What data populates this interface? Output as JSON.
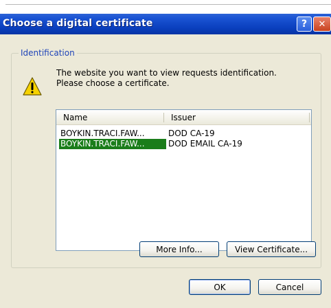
{
  "dialog": {
    "title": "Choose a digital certificate",
    "help_glyph": "?",
    "close_glyph": "✕"
  },
  "group": {
    "label": "Identification",
    "message_line1": "The website you want to view requests identification.",
    "message_line2": "Please choose a certificate.",
    "icon": "warning-icon"
  },
  "certificates": {
    "columns": [
      "Name",
      "Issuer"
    ],
    "rows": [
      {
        "name": "BOYKIN.TRACI.FAW...",
        "issuer": "DOD CA-19",
        "selected": false
      },
      {
        "name": "BOYKIN.TRACI.FAW...",
        "issuer": "DOD EMAIL CA-19",
        "selected": true
      }
    ],
    "selected_color": "#1a7d1a"
  },
  "buttons": {
    "more_info": "More Info...",
    "view_certificate": "View Certificate...",
    "ok": "OK",
    "cancel": "Cancel"
  },
  "colors": {
    "titlebar": "#0a3fbd",
    "dialog_bg": "#ece9d8",
    "group_label": "#1f44b8"
  }
}
